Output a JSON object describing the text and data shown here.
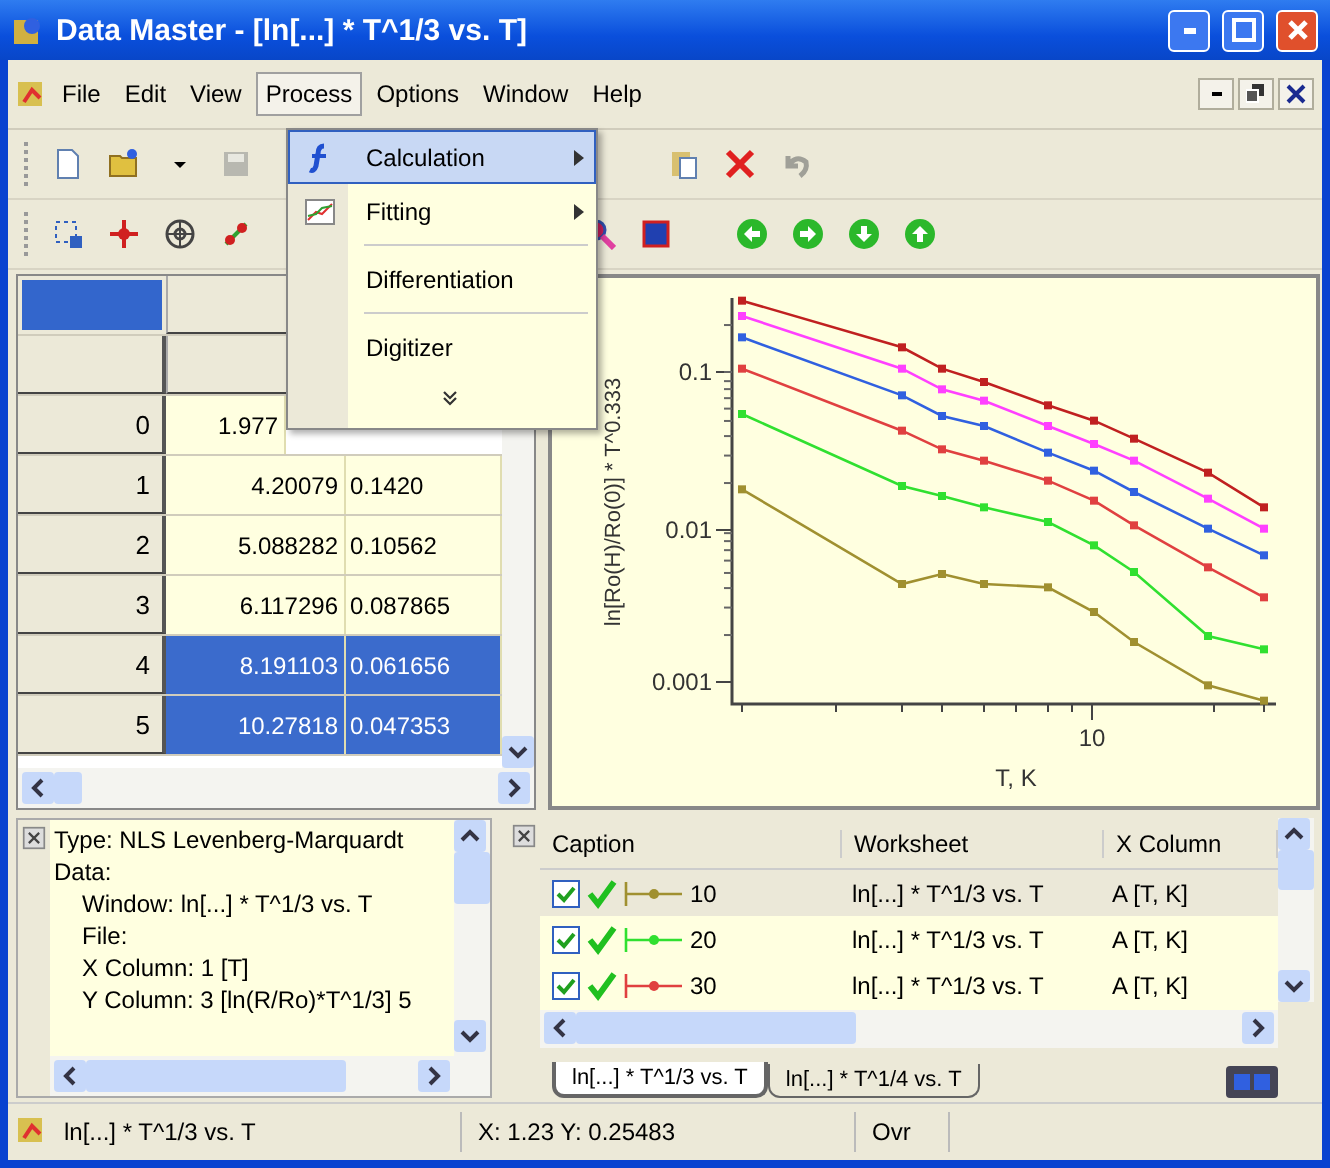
{
  "window": {
    "title": "Data Master - [ln[...] * T^1/3 vs. T]"
  },
  "menu_bar": [
    {
      "label": "File",
      "selected": false
    },
    {
      "label": "Edit",
      "selected": false
    },
    {
      "label": "View",
      "selected": false
    },
    {
      "label": "Process",
      "selected": true
    },
    {
      "label": "Options",
      "selected": false
    },
    {
      "label": "Window",
      "selected": false
    },
    {
      "label": "Help",
      "selected": false
    }
  ],
  "process_menu": [
    {
      "kind": "submenu",
      "label": "Calculation",
      "selected": true
    },
    {
      "kind": "submenu",
      "label": "Fitting",
      "selected": false
    },
    {
      "kind": "separator"
    },
    {
      "kind": "item",
      "label": "Differentiation",
      "selected": false
    },
    {
      "kind": "separator"
    },
    {
      "kind": "item",
      "label": "Digitizer",
      "selected": false
    },
    {
      "kind": "more"
    }
  ],
  "worksheet": {
    "rows": [
      {
        "index": "0",
        "cells": [
          "1.977"
        ],
        "selected": false
      },
      {
        "index": "1",
        "cells": [
          "4.20079",
          "0.1420"
        ],
        "selected": false
      },
      {
        "index": "2",
        "cells": [
          "5.088282",
          "0.10562"
        ],
        "selected": false
      },
      {
        "index": "3",
        "cells": [
          "6.117296",
          "0.087865"
        ],
        "selected": false
      },
      {
        "index": "4",
        "cells": [
          "8.191103",
          "0.061656"
        ],
        "selected": true
      },
      {
        "index": "5",
        "cells": [
          "10.27818",
          "0.047353"
        ],
        "selected": true
      }
    ]
  },
  "plot": {
    "ylabel": "ln[Ro(H)/Ro(0)] * T^0.333",
    "xlabel": "T, K",
    "yticks": [
      "0.1",
      "0.01",
      "0.001"
    ],
    "xticks": [
      "10"
    ]
  },
  "info_panel": {
    "lines": [
      {
        "text": "Type: NLS Levenberg-Marquardt"
      },
      {
        "text": "Data:",
        "children": [
          {
            "text": "Window: ln[...] * T^1/3 vs. T"
          },
          {
            "text": "File:"
          },
          {
            "text": "X Column: 1 [T]"
          },
          {
            "text": "Y Column: 3 [ln(R/Ro)*T^1/3] 5"
          }
        ]
      }
    ]
  },
  "curves_panel": {
    "columns": [
      "Caption",
      "Worksheet",
      "X Column"
    ],
    "rows": [
      {
        "checked": true,
        "color": "#a09030",
        "caption": "10",
        "worksheet": "ln[...] * T^1/3 vs. T",
        "x_column": "A [T, K]",
        "selected": true
      },
      {
        "checked": true,
        "color": "#30e030",
        "caption": "20",
        "worksheet": "ln[...] * T^1/3 vs. T",
        "x_column": "A [T, K]",
        "selected": false
      },
      {
        "checked": true,
        "color": "#e04040",
        "caption": "30",
        "worksheet": "ln[...] * T^1/3 vs. T",
        "x_column": "A [T, K]",
        "selected": false
      }
    ],
    "tabs": [
      {
        "label": "ln[...] * T^1/3 vs. T",
        "selected": true
      },
      {
        "label": "ln[...] * T^1/4  vs. T",
        "selected": false
      }
    ]
  },
  "status_bar": [
    "ln[...] * T^1/3 vs. T",
    "X: 1.23 Y: 0.25483",
    "Ovr"
  ]
}
